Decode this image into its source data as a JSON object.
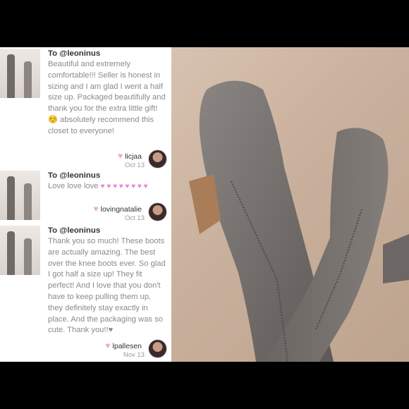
{
  "reviews": [
    {
      "to": "To @leoninus",
      "text": "Beautiful and extremely comfortable!!! Seller is honest in sizing and I am glad I went a half size up. Packaged beautifully and thank you for the extra little gift! ☺️ absolutely recommend this closet to everyone!",
      "user": "licjaa",
      "date": "Oct 13"
    },
    {
      "to": "To @leoninus",
      "text": "Love love love",
      "hearts": "♥ ♥ ♥ ♥ ♥ ♥ ♥ ♥",
      "user": "lovingnatalie",
      "date": "Oct 13"
    },
    {
      "to": "To @leoninus",
      "text": "Thank you so much! These boots are actually amazing. The best over the knee boots ever. So glad I got half a size up! They fit perfect! And I love that you don't have to keep pulling them up, they definitely stay exactly in place. And the packaging was so cute. Thank you!!♥",
      "user": "lpallesen",
      "date": "Nov 13"
    }
  ],
  "icons": {
    "like": "heart-icon",
    "avatar": "user-avatar"
  },
  "colors": {
    "heart_pink": "#e983d6",
    "like_pink": "#f5a6c3",
    "boot_gray": "#6f6a67"
  }
}
